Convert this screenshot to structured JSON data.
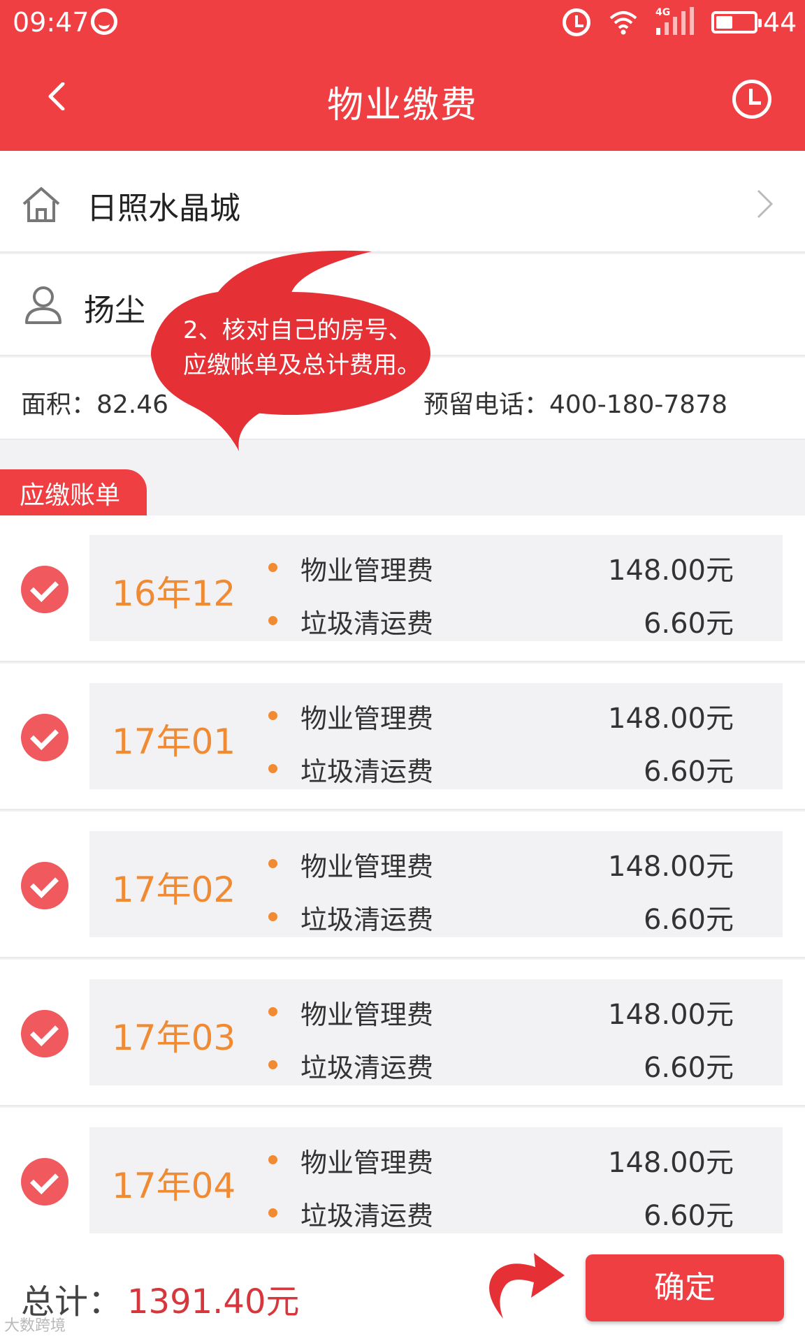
{
  "status_bar": {
    "time": "09:47",
    "network": "4G",
    "battery": "44",
    "battery_level_percent": 44
  },
  "header": {
    "title": "物业缴费"
  },
  "info": {
    "community": "日照水晶城",
    "owner": "扬尘",
    "area_text": "面积：82.46",
    "phone_text": "预留电话：400-180-7878"
  },
  "annotation": {
    "line1": "2、核对自己的房号、",
    "line2": "应缴帐单及总计费用。"
  },
  "bills": {
    "tab_label": "应缴账单",
    "items": [
      {
        "month": "16年12",
        "fees": [
          {
            "name": "物业管理费",
            "amount": "148.00元"
          },
          {
            "name": "垃圾清运费",
            "amount": "6.60元"
          }
        ]
      },
      {
        "month": "17年01",
        "fees": [
          {
            "name": "物业管理费",
            "amount": "148.00元"
          },
          {
            "name": "垃圾清运费",
            "amount": "6.60元"
          }
        ]
      },
      {
        "month": "17年02",
        "fees": [
          {
            "name": "物业管理费",
            "amount": "148.00元"
          },
          {
            "name": "垃圾清运费",
            "amount": "6.60元"
          }
        ]
      },
      {
        "month": "17年03",
        "fees": [
          {
            "name": "物业管理费",
            "amount": "148.00元"
          },
          {
            "name": "垃圾清运费",
            "amount": "6.60元"
          }
        ]
      },
      {
        "month": "17年04",
        "fees": [
          {
            "name": "物业管理费",
            "amount": "148.00元"
          },
          {
            "name": "垃圾清运费",
            "amount": "6.60元"
          }
        ]
      }
    ]
  },
  "footer": {
    "total_label": "总计：",
    "total_value": "1391.40元",
    "confirm_label": "确定",
    "watermark": "大数跨境"
  },
  "colors": {
    "primary_red": "#ef3f43",
    "check_red": "#f0595d",
    "orange": "#f08a33",
    "total_red": "#d6363c",
    "background": "#f2f2f4"
  },
  "icons": [
    "circle-icon",
    "alarm-icon",
    "wifi-icon",
    "signal-icon",
    "battery-icon",
    "back-icon",
    "history-icon",
    "home-icon",
    "user-icon",
    "chevron-right-icon",
    "check-icon",
    "bullet-icon",
    "arrow-icon"
  ]
}
